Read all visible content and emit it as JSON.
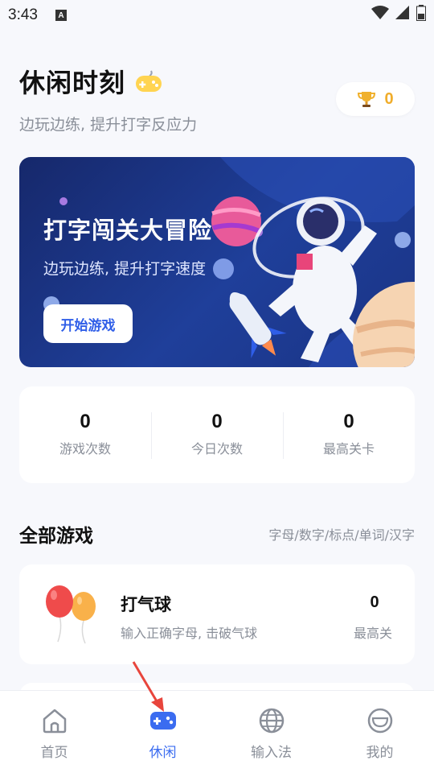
{
  "status_bar": {
    "time": "3:43",
    "notification": "A"
  },
  "header": {
    "title": "休闲时刻",
    "subtitle": "边玩边练, 提升打字反应力",
    "trophy_count": "0"
  },
  "banner": {
    "title": "打字闯关大冒险",
    "subtitle": "边玩边练, 提升打字速度",
    "button_label": "开始游戏"
  },
  "stats": [
    {
      "value": "0",
      "label": "游戏次数"
    },
    {
      "value": "0",
      "label": "今日次数"
    },
    {
      "value": "0",
      "label": "最高关卡"
    }
  ],
  "section": {
    "title": "全部游戏",
    "filters": "字母/数字/标点/单词/汉字"
  },
  "games": [
    {
      "name": "打气球",
      "description": "输入正确字母, 击破气球",
      "level": "0",
      "level_label": "最高关"
    }
  ],
  "tabs": [
    {
      "label": "首页",
      "icon": "home-icon",
      "active": false
    },
    {
      "label": "休闲",
      "icon": "gamepad-icon",
      "active": true
    },
    {
      "label": "输入法",
      "icon": "globe-icon",
      "active": false
    },
    {
      "label": "我的",
      "icon": "smile-icon",
      "active": false
    }
  ],
  "colors": {
    "accent": "#3b6cf0",
    "trophy": "#f0ad2b",
    "annotation_arrow": "#e8453c"
  }
}
